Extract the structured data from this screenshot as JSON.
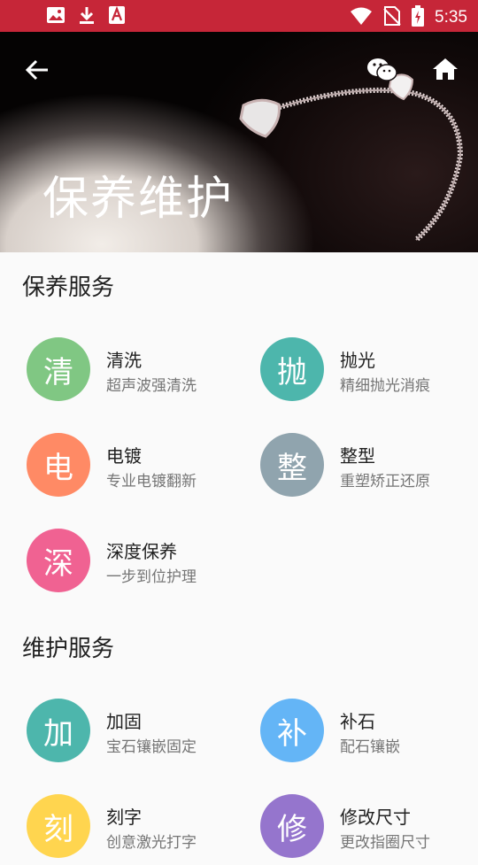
{
  "status_bar": {
    "time": "5:35",
    "left_icons": [
      "image-icon",
      "download-icon",
      "text-file-icon"
    ],
    "right_icons": [
      "wifi-icon",
      "no-sim-icon",
      "battery-charging-icon"
    ]
  },
  "header": {
    "title": "保养维护",
    "back_icon": "arrow-back-icon",
    "share_icon": "wechat-icon",
    "home_icon": "home-icon"
  },
  "sections": [
    {
      "title": "保养服务",
      "items": [
        {
          "glyph": "清",
          "title": "清洗",
          "subtitle": "超声波强清洗",
          "color": "#80c783"
        },
        {
          "glyph": "抛",
          "title": "抛光",
          "subtitle": "精细抛光消痕",
          "color": "#4db6ac"
        },
        {
          "glyph": "电",
          "title": "电镀",
          "subtitle": "专业电镀翻新",
          "color": "#ff8a65"
        },
        {
          "glyph": "整",
          "title": "整型",
          "subtitle": "重塑矫正还原",
          "color": "#90a4ae"
        },
        {
          "glyph": "深",
          "title": "深度保养",
          "subtitle": "一步到位护理",
          "color": "#f06292"
        }
      ]
    },
    {
      "title": "维护服务",
      "items": [
        {
          "glyph": "加",
          "title": "加固",
          "subtitle": "宝石镶嵌固定",
          "color": "#4db6ac"
        },
        {
          "glyph": "补",
          "title": "补石",
          "subtitle": "配石镶嵌",
          "color": "#64b5f6"
        },
        {
          "glyph": "刻",
          "title": "刻字",
          "subtitle": "创意激光打字",
          "color": "#ffd54f"
        },
        {
          "glyph": "修",
          "title": "修改尺寸",
          "subtitle": "更改指圈尺寸",
          "color": "#9575cd"
        }
      ]
    }
  ]
}
